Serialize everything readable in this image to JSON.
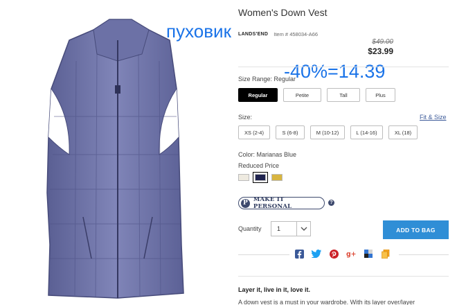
{
  "annotations": {
    "word": "пуховик",
    "discount": "-40%=14.39"
  },
  "product": {
    "title": "Women's Down Vest",
    "brand": "LANDS'END",
    "item_number": "Item # 458034-A66",
    "price_original": "$49.00",
    "price_current": "$23.99",
    "image_icon": "vest-image"
  },
  "size_range": {
    "label": "Size Range: Regular",
    "options": [
      "Regular",
      "Petite",
      "Tall",
      "Plus"
    ],
    "selected": "Regular"
  },
  "size": {
    "label": "Size:",
    "fit_link": "Fit & Size",
    "options": [
      "XS (2-4)",
      "S (6-8)",
      "M (10-12)",
      "L (14-16)",
      "XL (18)"
    ]
  },
  "color": {
    "label": "Color: Marianas Blue",
    "note": "Reduced Price",
    "swatches": [
      "#eeeae0",
      "#1f2450",
      "#d8b540"
    ],
    "selected_index": 1
  },
  "personal": {
    "badge": "P",
    "label": "MAKE IT PERSONAL",
    "help_icon": "question-icon"
  },
  "quantity": {
    "label": "Quantity",
    "value": "1"
  },
  "cart": {
    "button_label": "ADD TO BAG"
  },
  "share": {
    "icons": [
      "facebook-icon",
      "twitter-icon",
      "pinterest-icon",
      "google-plus-icon",
      "delicious-icon",
      "email-icon"
    ]
  },
  "description": {
    "title": "Layer it, live in it, love it.",
    "body": "A down vest is a must in your wardrobe. With its layer over/layer"
  }
}
